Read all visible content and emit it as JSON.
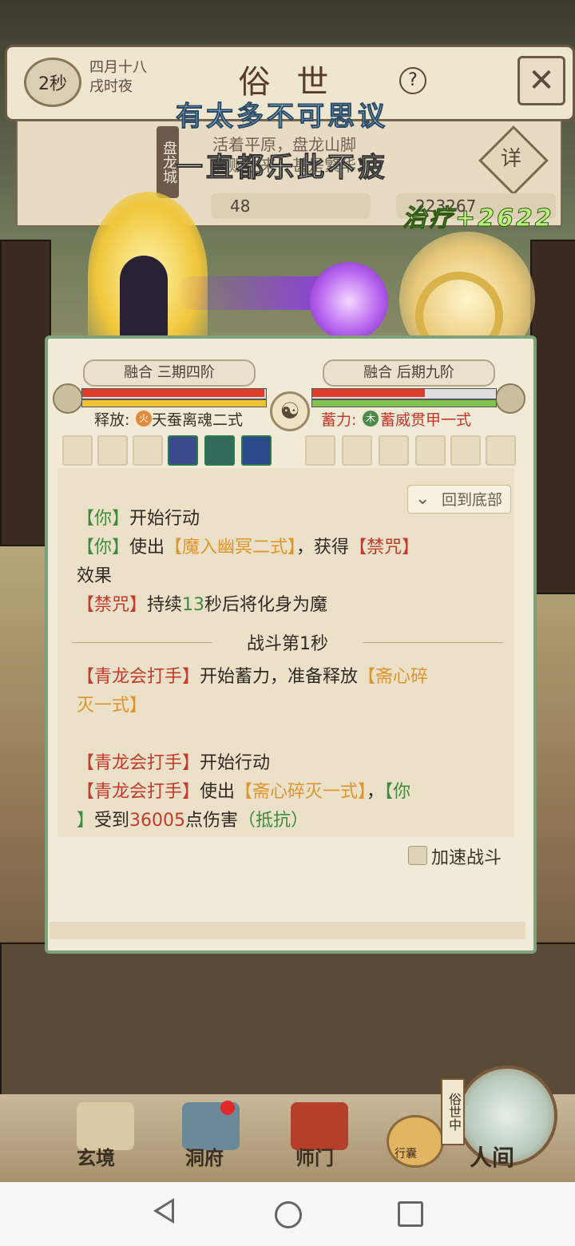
{
  "header": {
    "timer": "2秒",
    "date_line1": "四月十八",
    "date_line2": "戌时夜",
    "realm_title": "俗 世",
    "help_icon": "?",
    "close_icon": "close-x-icon"
  },
  "city": {
    "name": "盘龙城",
    "desc_line1": "活着平原，盘龙山脚",
    "desc_line2": "商贩往来，甚是繁华",
    "detail_label": "详",
    "stat_left": "48",
    "stat_right": "223267"
  },
  "captions": {
    "line1": "有太多不可思议",
    "line2": "一直都乐此不疲"
  },
  "effects": {
    "heal_text": "治疗+2622"
  },
  "battle": {
    "left_realm": "融合 三期四阶",
    "right_realm": "融合 后期九阶",
    "release_label": "释放:",
    "release_element": "火",
    "release_skill": "天蚕离魂二式",
    "charge_label": "蓄力:",
    "charge_element": "木",
    "charge_skill": "蓄威贯甲一式",
    "hp_left_fraction": 1.0,
    "hp_right_fraction": 0.62
  },
  "log": {
    "back_to_bottom": "回到底部",
    "lines": [
      {
        "a": "【你】",
        "b": "开始行动"
      },
      {
        "a": "【你】",
        "b": "使出",
        "c": "【魔入幽冥二式】",
        "d": "，获得",
        "e": "【禁咒】"
      },
      {
        "b": "效果"
      },
      {
        "a": "【禁咒】",
        "b": "持续",
        "c": "13",
        "d": "秒后将化身为魔"
      }
    ],
    "round_label": "战斗第1秒",
    "lines2": [
      {
        "a": "【青龙会打手】",
        "b": "开始蓄力，准备释放",
        "c": "【斋心碎"
      },
      {
        "c": "灭一式】"
      },
      {
        "a": "【青龙会打手】",
        "b": "开始行动"
      },
      {
        "a": "【青龙会打手】",
        "b": "使出",
        "c": "【斋心碎灭一式】",
        "d": "，",
        "e": "【你"
      },
      {
        "e": "】",
        "b": "受到",
        "c": "36005",
        "d": "点伤害",
        "f": "（抵抗）"
      }
    ],
    "speed_label": "加速战斗"
  },
  "nav": {
    "items": [
      {
        "label": "玄境"
      },
      {
        "label": "洞府"
      },
      {
        "label": "师门"
      },
      {
        "label": "行囊"
      },
      {
        "label": "人间"
      }
    ],
    "world_tag": "俗世中"
  },
  "colors": {
    "panel_border": "#7da27a",
    "hp": "#e13b2b",
    "qi_left": "#f1c232",
    "qi_right": "#7fc24f",
    "heal": "#b8f07a"
  }
}
